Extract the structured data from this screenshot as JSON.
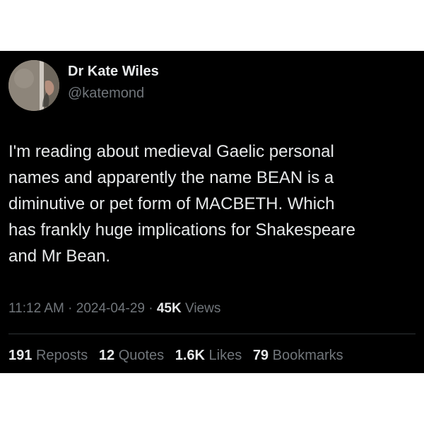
{
  "author": {
    "name": "Dr Kate Wiles",
    "handle": "@katemond"
  },
  "tweet": {
    "text_lines": [
      "I'm reading about medieval Gaelic personal",
      "names and apparently the name BEAN is a",
      "diminutive or pet form of MACBETH. Which",
      "has frankly huge implications for Shakespeare",
      "and Mr Bean."
    ]
  },
  "meta": {
    "time": "11:12 AM",
    "sep1": "·",
    "date": "2024-04-29",
    "sep2": "·",
    "views_count": "45K",
    "views_label": "Views"
  },
  "stats": {
    "reposts_count": "191",
    "reposts_label": "Reposts",
    "quotes_count": "12",
    "quotes_label": "Quotes",
    "likes_count": "1.6K",
    "likes_label": "Likes",
    "bookmarks_count": "79",
    "bookmarks_label": "Bookmarks"
  },
  "colors": {
    "background": "#000000",
    "primary_text": "#e7e9ea",
    "secondary_text": "#71767b",
    "divider": "#2f3336"
  }
}
